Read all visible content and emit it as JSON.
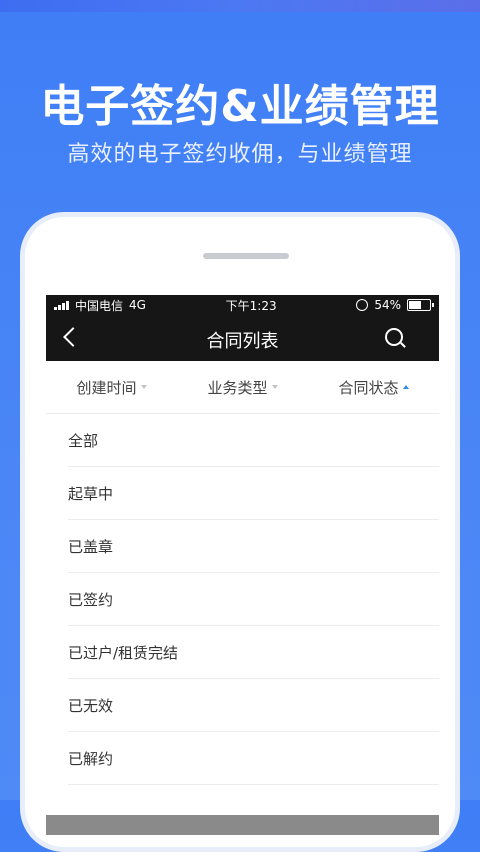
{
  "promo": {
    "title": "电子签约&业绩管理",
    "subtitle": "高效的电子签约收佣，与业绩管理"
  },
  "status_bar": {
    "carrier": "中国电信",
    "network": "4G",
    "time": "下午1:23",
    "battery": "54%"
  },
  "nav": {
    "title": "合同列表"
  },
  "filters": [
    {
      "label": "创建时间"
    },
    {
      "label": "业务类型"
    },
    {
      "label": "合同状态"
    }
  ],
  "list": [
    {
      "label": "全部"
    },
    {
      "label": "起草中"
    },
    {
      "label": "已盖章"
    },
    {
      "label": "已签约"
    },
    {
      "label": "已过户/租赁完结"
    },
    {
      "label": "已无效"
    },
    {
      "label": "已解约"
    }
  ],
  "colors": {
    "background": "#4a86f5",
    "active_caret": "#2f8cf0"
  }
}
